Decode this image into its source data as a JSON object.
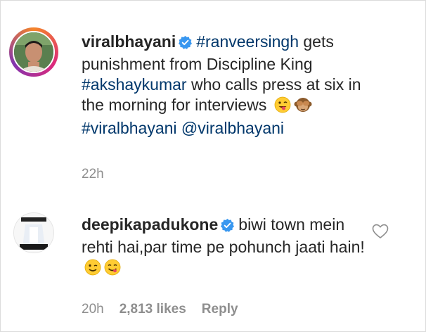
{
  "comments": [
    {
      "username": "viralbhayani",
      "text_parts": [
        {
          "type": "tag",
          "text": "#ranveersingh"
        },
        {
          "type": "text",
          "text": " gets punishment from Discipline King "
        },
        {
          "type": "tag",
          "text": "#akshaykumar"
        },
        {
          "type": "text",
          "text": " who calls press at six in the morning for interviews "
        }
      ],
      "line2_tags": [
        "#viralbhayani",
        "@viralbhayani"
      ],
      "time": "22h",
      "emojis": [
        "tongue-wink-emoji",
        "see-no-evil-monkey-emoji"
      ]
    },
    {
      "username": "deepikapadukone",
      "text": "biwi town mein rehti hai,par time pe pohunch jaati hain!",
      "time": "20h",
      "likes": "2,813 likes",
      "reply": "Reply",
      "emojis": [
        "wink-emoji",
        "yum-emoji"
      ]
    }
  ],
  "colors": {
    "text": "#262626",
    "tag": "#00376b",
    "meta": "#8e8e8e",
    "verified": "#3897f0"
  }
}
